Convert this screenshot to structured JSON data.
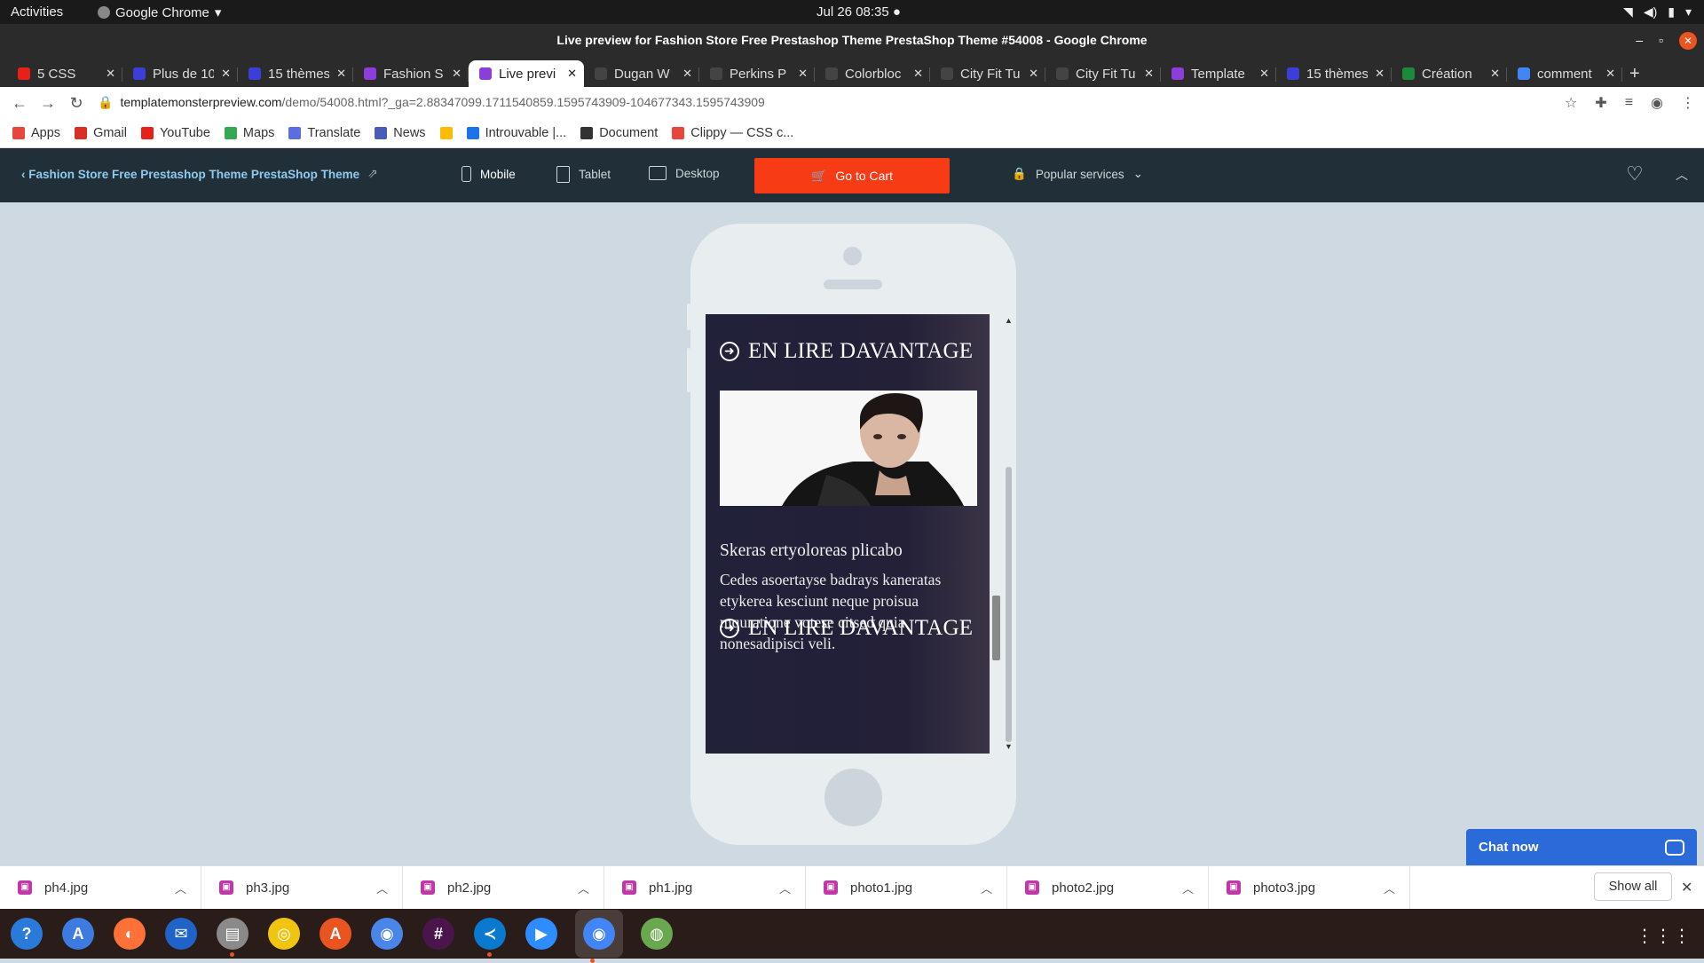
{
  "system": {
    "activities": "Activities",
    "app_name": "Google Chrome",
    "clock": "Jul 26  08:35"
  },
  "window": {
    "title": "Live preview for Fashion Store Free Prestashop Theme PrestaShop Theme #54008 - Google Chrome"
  },
  "tabs": [
    {
      "label": "5 CSS",
      "icon": "youtube-icon",
      "color": "#e62117"
    },
    {
      "label": "Plus de 10",
      "icon": "c-logo-icon",
      "color": "#3b3fd8"
    },
    {
      "label": "15 thèmes",
      "icon": "c-logo-icon",
      "color": "#3b3fd8"
    },
    {
      "label": "Fashion S",
      "icon": "templatemonster-icon",
      "color": "#8b3fd8"
    },
    {
      "label": "Live previ",
      "icon": "templatemonster-icon",
      "color": "#8b3fd8"
    },
    {
      "label": "Dugan W",
      "icon": "bv-icon",
      "color": "#444444"
    },
    {
      "label": "Perkins P",
      "icon": "bv-icon",
      "color": "#444444"
    },
    {
      "label": "Colorbloc",
      "icon": "bv-icon",
      "color": "#444444"
    },
    {
      "label": "City Fit Tu",
      "icon": "bv-icon",
      "color": "#444444"
    },
    {
      "label": "City Fit Tu",
      "icon": "bv-icon",
      "color": "#444444"
    },
    {
      "label": "Template",
      "icon": "templatemonster-icon",
      "color": "#8b3fd8"
    },
    {
      "label": "15 thèmes",
      "icon": "c-logo-icon",
      "color": "#3b3fd8"
    },
    {
      "label": "Création",
      "icon": "globe-green-icon",
      "color": "#1b8a3a"
    },
    {
      "label": "comment",
      "icon": "google-icon",
      "color": "#4285f4"
    }
  ],
  "address": {
    "host": "templatemonsterpreview.com",
    "path": "/demo/54008.html?_ga=2.88347099.1711540859.1595743909-104677343.1595743909"
  },
  "bookmarks": [
    {
      "label": "Apps",
      "icon": "apps-grid-icon"
    },
    {
      "label": "Gmail",
      "icon": "gmail-icon"
    },
    {
      "label": "YouTube",
      "icon": "youtube-icon"
    },
    {
      "label": "Maps",
      "icon": "maps-icon"
    },
    {
      "label": "Translate",
      "icon": "translate-icon"
    },
    {
      "label": "News",
      "icon": "news-icon"
    },
    {
      "label": "",
      "icon": "drive-icon"
    },
    {
      "label": "Introuvable |...",
      "icon": "page-icon"
    },
    {
      "label": "Document",
      "icon": "github-icon"
    },
    {
      "label": "Clippy — CSS c...",
      "icon": "clippy-icon"
    }
  ],
  "preview_toolbar": {
    "back_label": "Fashion Store Free Prestashop Theme PrestaShop Theme",
    "devices": {
      "mobile": "Mobile",
      "tablet": "Tablet",
      "desktop": "Desktop"
    },
    "active_device": "mobile",
    "cart_label": "Go to Cart",
    "popular_label": "Popular services",
    "colors": {
      "bg": "#213038",
      "cart": "#f73b15",
      "link": "#8ecaf0"
    }
  },
  "phone_screen": {
    "read_more_1": "EN LIRE DAVANTAGE",
    "post_title": "Skeras ertyoloreas plicabo",
    "post_text": "Cedes asoertayse badrays kaneratas etykerea kesciunt neque proisua mqurationе votese citsed quia nonesadipisci veli.",
    "read_more_2": "EN LIRE DAVANTAGE",
    "inner_scroll_position": 0.75
  },
  "chat": {
    "label": "Chat now"
  },
  "downloads": {
    "files": [
      "ph4.jpg",
      "ph3.jpg",
      "ph2.jpg",
      "ph1.jpg",
      "photo1.jpg",
      "photo2.jpg",
      "photo3.jpg"
    ],
    "show_all": "Show all"
  },
  "dock": {
    "apps": [
      "help-icon",
      "translate-app-icon",
      "firefox-icon",
      "thunderbird-icon",
      "files-icon",
      "rhythmbox-icon",
      "software-icon",
      "chromium-icon",
      "slack-icon",
      "vscode-icon",
      "zoom-icon",
      "chrome-icon",
      "settings-globe-icon"
    ],
    "active": "chrome-icon"
  }
}
